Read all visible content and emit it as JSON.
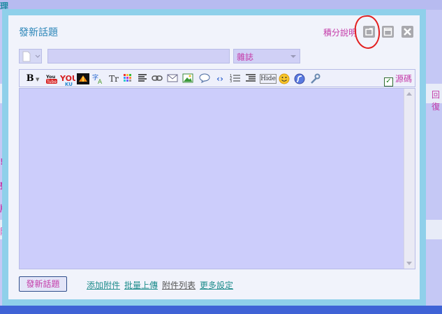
{
  "dialog": {
    "title": "發新話題",
    "help_link": "積分說明",
    "window_buttons": {
      "popout_icon": "popout-icon",
      "maximize_icon": "maximize-icon",
      "close_icon": "close-icon"
    }
  },
  "form": {
    "doc_type_icon": "document-icon",
    "subject_value": "",
    "category_selected": "雜誌"
  },
  "toolbar": {
    "bold": "B",
    "source_label": "源碼",
    "source_checked": true,
    "icons": [
      "bold-icon",
      "youtube-icon",
      "youku-icon",
      "flash-media-icon",
      "translate-icon",
      "font-size-icon",
      "color-palette-icon",
      "align-icon",
      "link-icon",
      "email-icon",
      "image-icon",
      "quote-icon",
      "code-icon",
      "ordered-list-icon",
      "indent-list-icon",
      "hide-icon",
      "smiley-icon",
      "flash-icon",
      "wrench-icon"
    ],
    "hide_label": "Hide",
    "youtube_label": "You Tube",
    "youku_label": "YOU KU",
    "font_label": "Tr"
  },
  "footer": {
    "submit_label": "發新話題",
    "links": [
      "添加附件",
      "批量上傳",
      "附件列表",
      "更多設定"
    ]
  },
  "background": {
    "left_chars": [
      "理",
      "!",
      "聲",
      "版",
      "附"
    ],
    "right_chars": [
      "回復"
    ]
  }
}
